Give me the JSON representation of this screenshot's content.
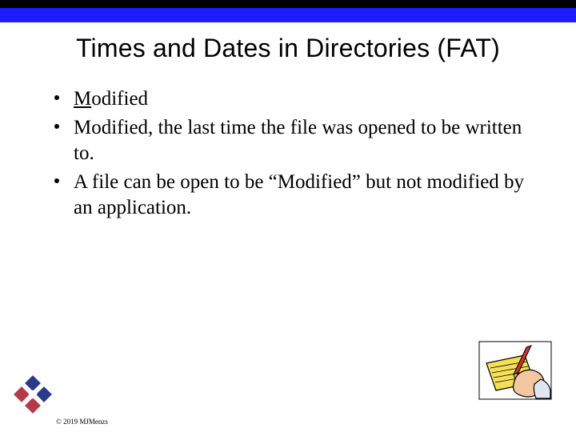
{
  "title": "Times and Dates in Directories (FAT)",
  "bullets": {
    "b1_uchar": "M",
    "b1_rest": "odified",
    "b2": "Modified, the last time the file was opened to be written to.",
    "b3": "A file can be open to be “Modified” but not modified by an application."
  },
  "footer": "© 2019 MJMenzs",
  "clipart_desc": "hand-writing-notepad-icon",
  "logo_desc": "four-diamond-logo"
}
